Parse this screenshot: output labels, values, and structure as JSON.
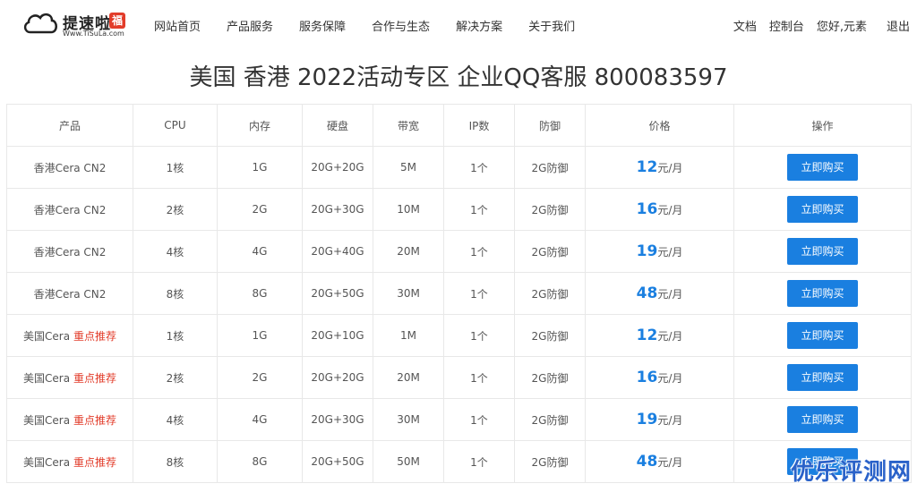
{
  "header": {
    "logo_name": "提速啦",
    "logo_badge": "福",
    "logo_url": "Www.TiSuLa.com",
    "nav": [
      "网站首页",
      "产品服务",
      "服务保障",
      "合作与生态",
      "解决方案",
      "关于我们"
    ],
    "right": {
      "docs": "文档",
      "console": "控制台",
      "greeting": "您好,元素",
      "logout": "退出"
    }
  },
  "title": "美国 香港 2022活动专区 企业QQ客服 800083597",
  "table": {
    "headers": [
      "产品",
      "CPU",
      "内存",
      "硬盘",
      "带宽",
      "IP数",
      "防御",
      "价格",
      "操作"
    ],
    "price_unit": "元/月",
    "buy_label": "立即购买",
    "rows": [
      {
        "product": "香港Cera CN2",
        "tag": "",
        "cpu": "1核",
        "ram": "1G",
        "disk": "20G+20G",
        "bw": "5M",
        "ip": "1个",
        "defense": "2G防御",
        "price": "12"
      },
      {
        "product": "香港Cera CN2",
        "tag": "",
        "cpu": "2核",
        "ram": "2G",
        "disk": "20G+30G",
        "bw": "10M",
        "ip": "1个",
        "defense": "2G防御",
        "price": "16"
      },
      {
        "product": "香港Cera CN2",
        "tag": "",
        "cpu": "4核",
        "ram": "4G",
        "disk": "20G+40G",
        "bw": "20M",
        "ip": "1个",
        "defense": "2G防御",
        "price": "19"
      },
      {
        "product": "香港Cera CN2",
        "tag": "",
        "cpu": "8核",
        "ram": "8G",
        "disk": "20G+50G",
        "bw": "30M",
        "ip": "1个",
        "defense": "2G防御",
        "price": "48"
      },
      {
        "product": "美国Cera",
        "tag": "重点推荐",
        "cpu": "1核",
        "ram": "1G",
        "disk": "20G+10G",
        "bw": "1M",
        "ip": "1个",
        "defense": "2G防御",
        "price": "12"
      },
      {
        "product": "美国Cera",
        "tag": "重点推荐",
        "cpu": "2核",
        "ram": "2G",
        "disk": "20G+20G",
        "bw": "20M",
        "ip": "1个",
        "defense": "2G防御",
        "price": "16"
      },
      {
        "product": "美国Cera",
        "tag": "重点推荐",
        "cpu": "4核",
        "ram": "4G",
        "disk": "20G+30G",
        "bw": "30M",
        "ip": "1个",
        "defense": "2G防御",
        "price": "19"
      },
      {
        "product": "美国Cera",
        "tag": "重点推荐",
        "cpu": "8核",
        "ram": "8G",
        "disk": "20G+50G",
        "bw": "50M",
        "ip": "1个",
        "defense": "2G防御",
        "price": "48"
      }
    ]
  },
  "watermark": "优乐评测网",
  "colors": {
    "accent": "#1a7fe0",
    "hot": "#e23c2a"
  }
}
